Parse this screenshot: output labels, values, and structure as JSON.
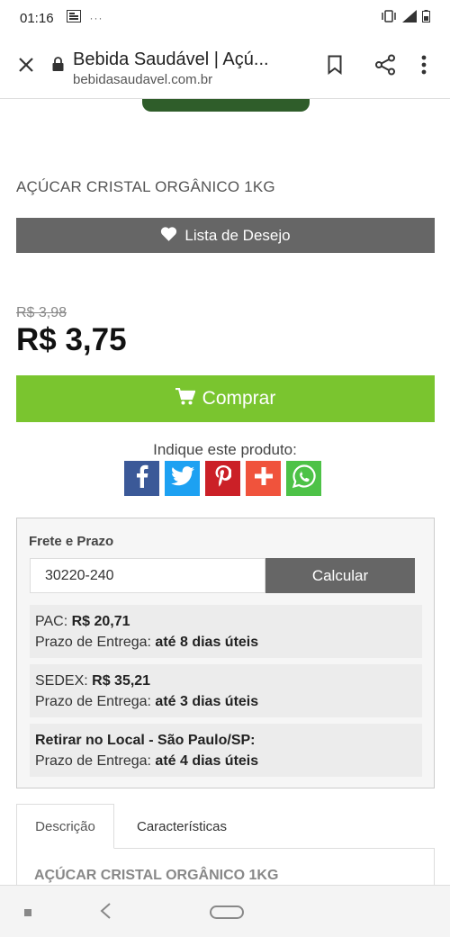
{
  "status_bar": {
    "time": "01:16",
    "extra": "···"
  },
  "browser": {
    "title": "Bebida Saudável | Açú...",
    "url": "bebidasaudavel.com.br"
  },
  "product": {
    "title": "AÇÚCAR CRISTAL ORGÂNICO 1KG",
    "wishlist_label": "Lista de Desejo",
    "old_price": "R$ 3,98",
    "price": "R$ 3,75",
    "buy_label": "Comprar",
    "share_label": "Indique este produto:"
  },
  "share": {
    "colors": {
      "facebook": "#3b5998",
      "twitter": "#1da1f2",
      "pinterest": "#cb2027",
      "plus": "#f0533c",
      "whatsapp": "#4dc247"
    }
  },
  "shipping": {
    "title": "Frete e Prazo",
    "cep_value": "30220-240",
    "calc_label": "Calcular",
    "options": [
      {
        "name": "PAC:",
        "price": "R$ 20,71",
        "deadline_label": "Prazo de Entrega:",
        "deadline": "até 8 dias úteis"
      },
      {
        "name": "SEDEX:",
        "price": "R$ 35,21",
        "deadline_label": "Prazo de Entrega:",
        "deadline": "até 3 dias úteis"
      },
      {
        "name": "Retirar no Local - São Paulo/SP:",
        "price": "",
        "deadline_label": "Prazo de Entrega:",
        "deadline": "até 4 dias úteis"
      }
    ]
  },
  "tabs": {
    "description": "Descrição",
    "characteristics": "Características",
    "description_title": "AÇÚCAR CRISTAL ORGÂNICO 1KG"
  },
  "colors": {
    "buy_green": "#7ac52f",
    "button_gray": "#666666"
  }
}
